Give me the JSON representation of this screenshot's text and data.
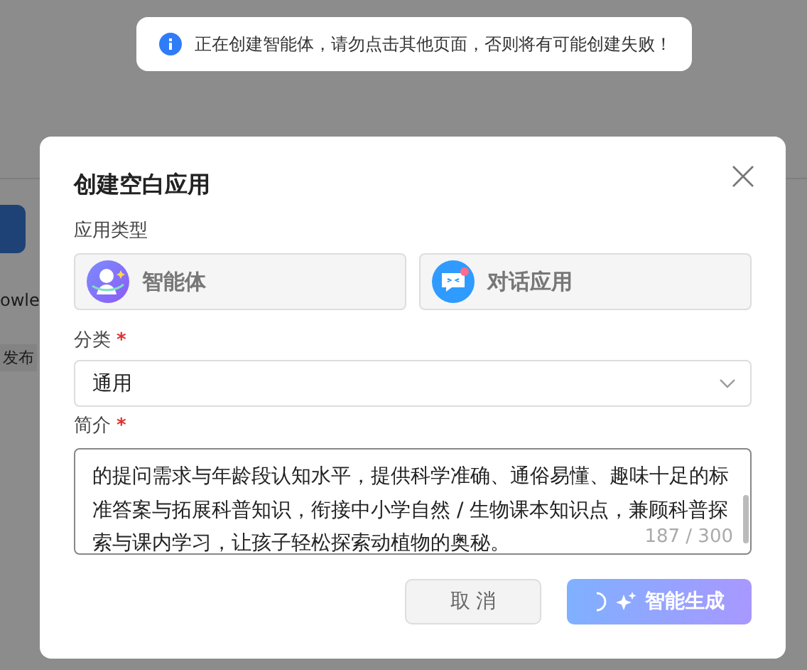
{
  "background": {
    "card_title": "owle",
    "card_action": "发布"
  },
  "toast": {
    "message": "正在创建智能体，请勿点击其他页面，否则将有可能创建失败！"
  },
  "dialog": {
    "title": "创建空白应用",
    "app_type": {
      "label": "应用类型",
      "options": [
        {
          "kind": "agent",
          "label": "智能体",
          "selected": false
        },
        {
          "kind": "chat",
          "label": "对话应用",
          "selected": false
        }
      ]
    },
    "category": {
      "label": "分类",
      "required_mark": "*",
      "value": "通用"
    },
    "intro": {
      "label": "简介",
      "required_mark": "*",
      "value": "的提问需求与年龄段认知水平，提供科学准确、通俗易懂、趣味十足的标准答案与拓展科普知识，衔接中小学自然 / 生物课本知识点，兼顾科普探索与课内学习，让孩子轻松探索动植物的奥秘。",
      "counter": "187 / 300"
    },
    "buttons": {
      "cancel": "取 消",
      "generate": {
        "label": "智能生成",
        "loading": true
      }
    }
  }
}
